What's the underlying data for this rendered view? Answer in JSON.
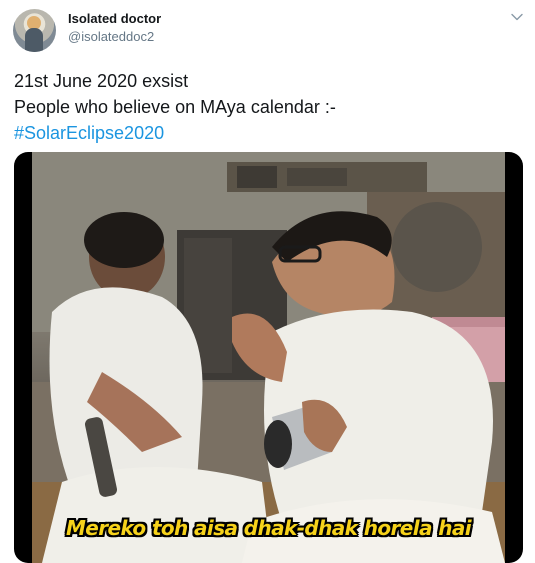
{
  "tweet": {
    "author_name": "Isolated doctor",
    "handle": "@isolateddoc2",
    "text_line1": "21st June 2020 exsist",
    "text_line2": "People who believe on MAya calendar :-",
    "hashtag": "#SolarEclipse2020"
  },
  "media": {
    "caption": "Mereko toh aisa dhak-dhak horela hai"
  },
  "icons": {
    "more": "chevron-down-icon"
  },
  "colors": {
    "link": "#1b95e0",
    "caption": "#f6d21a",
    "secondary_text": "#657786"
  }
}
